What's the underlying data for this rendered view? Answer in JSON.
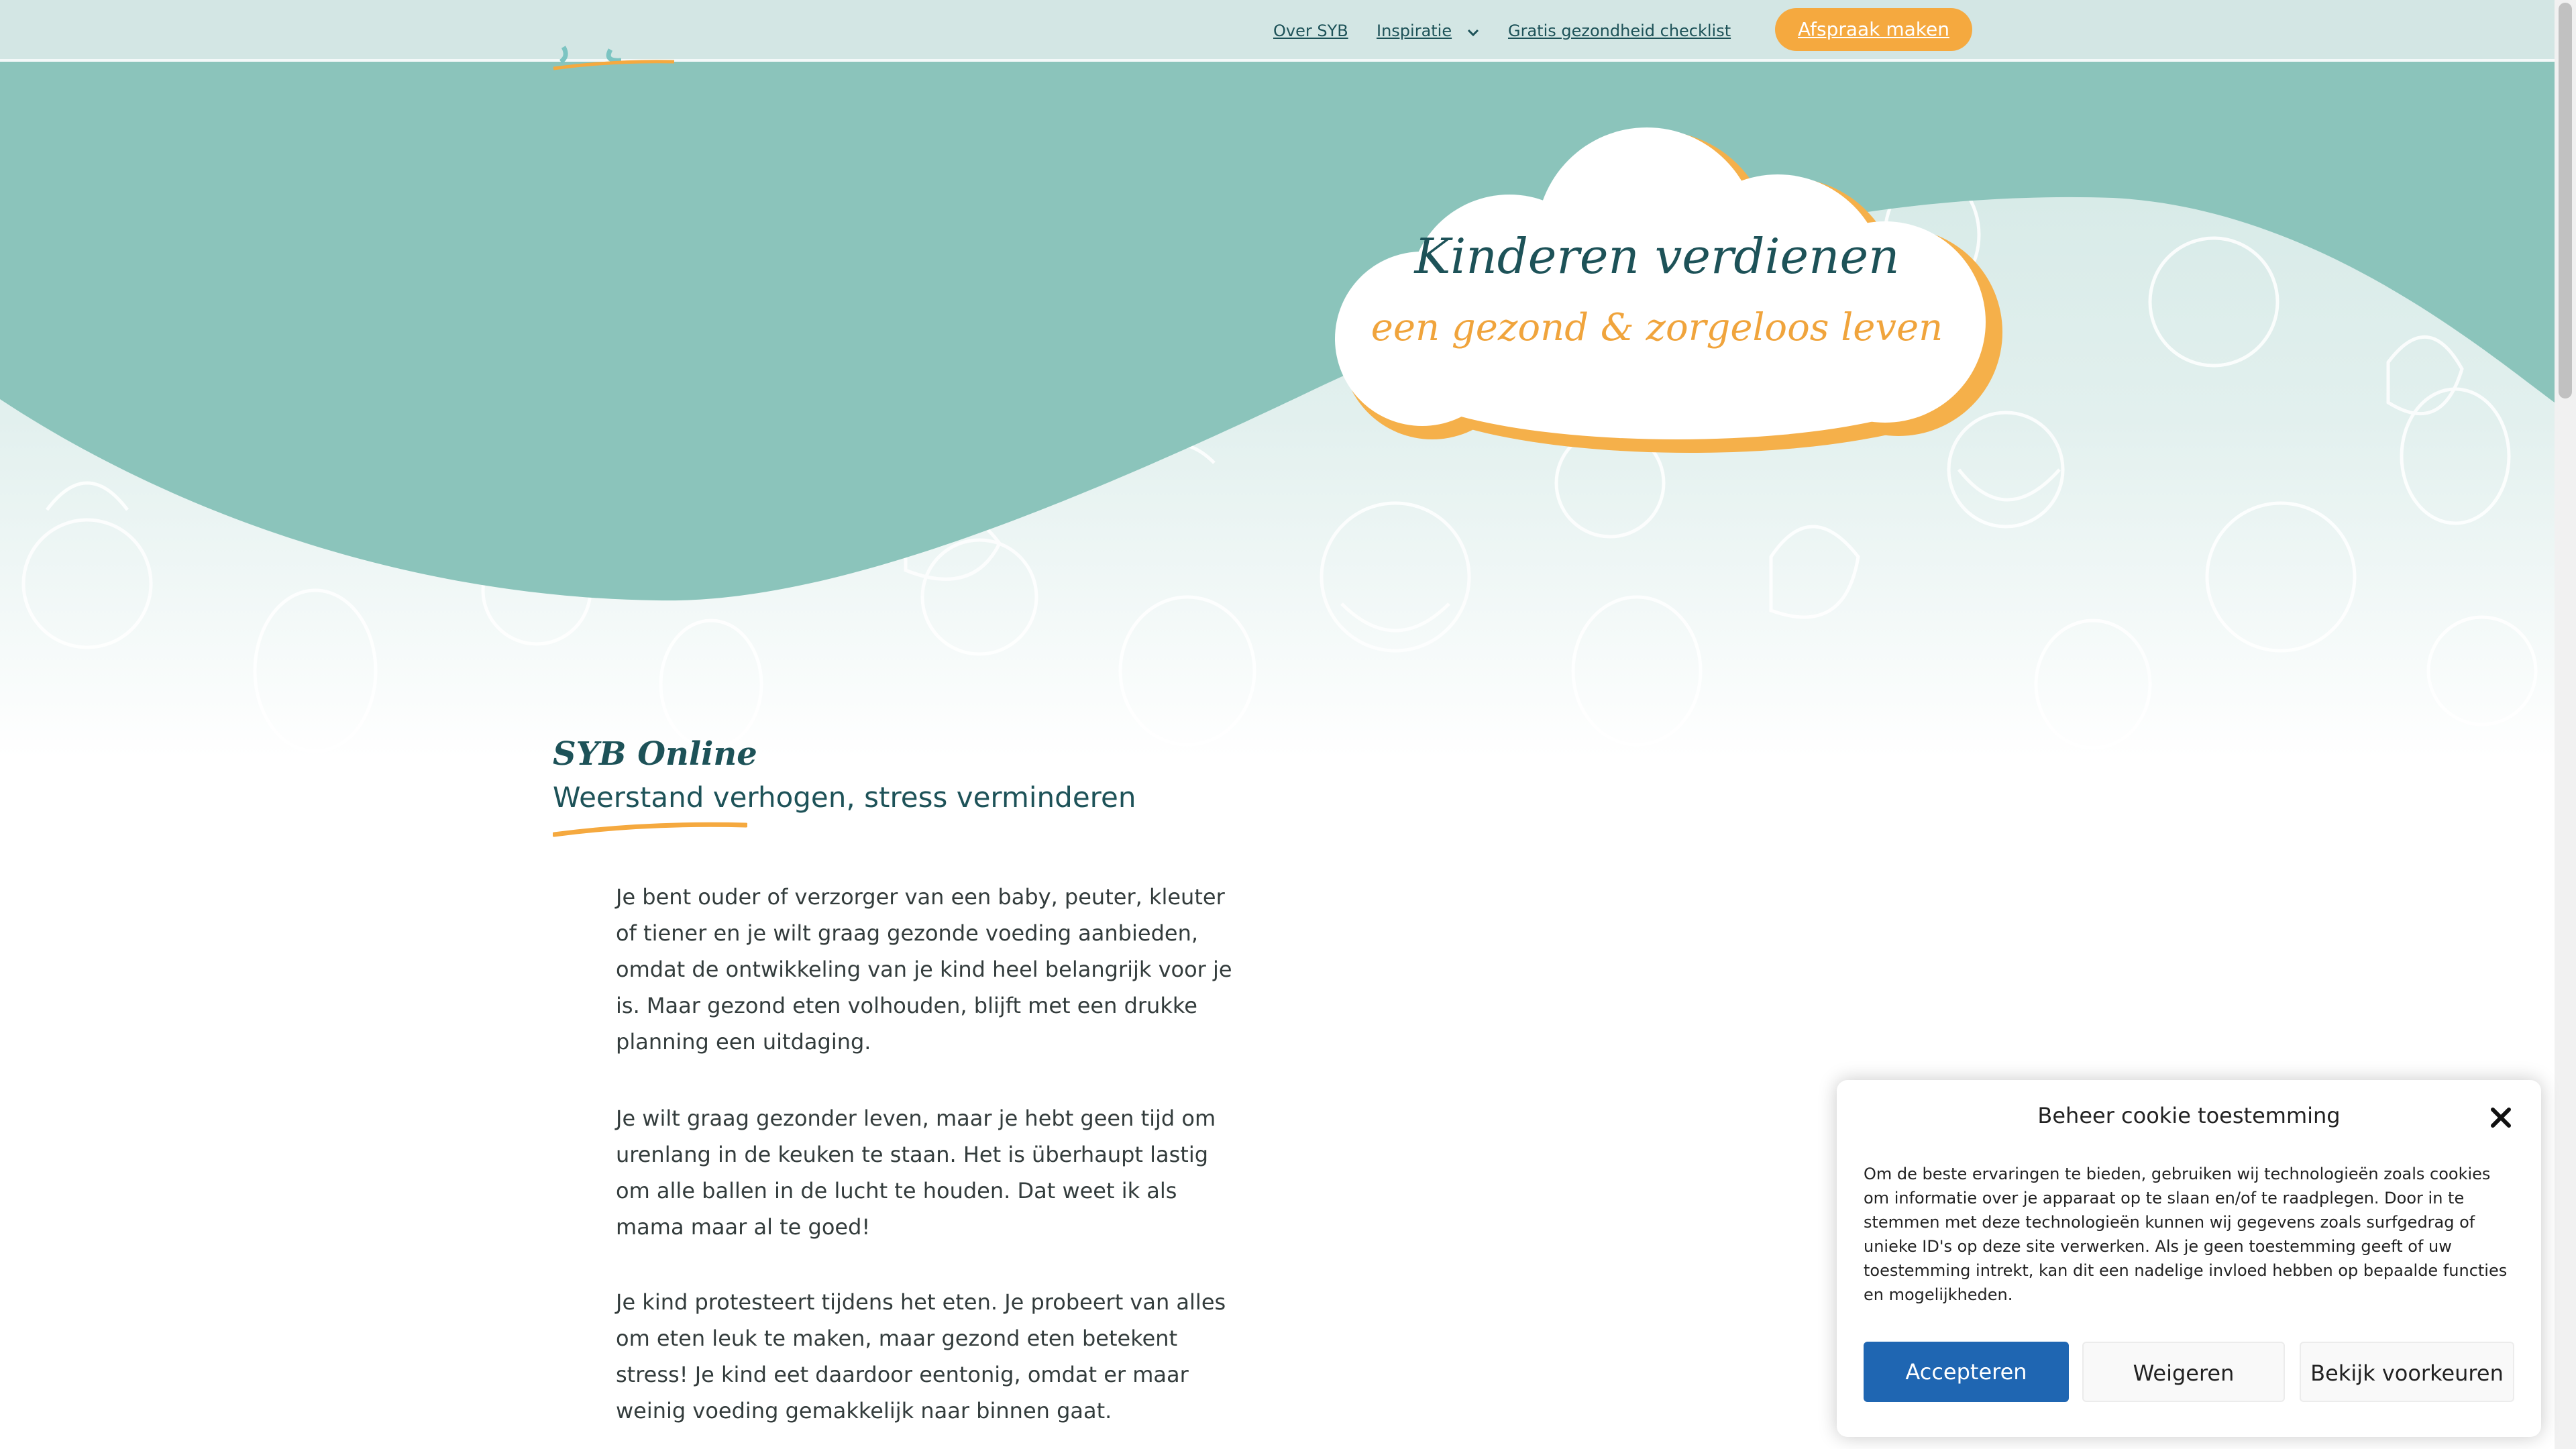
{
  "header": {
    "nav": {
      "over": "Over SYB",
      "inspiratie": "Inspiratie",
      "checklist": "Gratis gezondheid checklist"
    },
    "cta": "Afspraak maken"
  },
  "hero": {
    "title": "Kinderen verdienen",
    "subtitle": "een gezond & zorgeloos leven"
  },
  "section": {
    "title": "SYB Online",
    "subtitle": "Weerstand verhogen, stress verminderen",
    "paragraphs": [
      "Je bent ouder of verzorger van een baby, peuter, kleuter of tiener en je wilt graag gezonde voeding aanbieden, omdat de ontwikkeling van je kind heel belangrijk voor je is. Maar gezond eten volhouden, blijft met een drukke planning een uitdaging.",
      "Je wilt graag gezonder leven, maar je hebt geen tijd om urenlang in de keuken te staan. Het is überhaupt lastig om alle ballen in de lucht te houden. Dat weet ik als mama maar al te goed!",
      "Je kind protesteert tijdens het eten. Je probeert van alles om eten leuk te maken, maar gezond eten betekent stress! Je kind eet daardoor eentonig, omdat er maar weinig voeding gemakkelijk naar binnen gaat."
    ]
  },
  "cookie": {
    "title": "Beheer cookie toestemming",
    "text": "Om de beste ervaringen te bieden, gebruiken wij technologieën zoals cookies om informatie over je apparaat op te slaan en/of te raadplegen. Door in te stemmen met deze technologieën kunnen wij gegevens zoals surfgedrag of unieke ID's op deze site verwerken. Als je geen toestemming geeft of uw toestemming intrekt, kan dit een nadelige invloed hebben op bepaalde functies en mogelijkheden.",
    "accept": "Accepteren",
    "deny": "Weigeren",
    "prefs": "Bekijk voorkeuren"
  },
  "icons": {
    "close": "close-icon",
    "dropdown": "chevron-down-icon"
  },
  "colors": {
    "teal": "#8bc4bb",
    "dark_teal": "#1d5258",
    "orange": "#f5a93f",
    "accept_blue": "#1f66b2",
    "header_bg": "#d3e6e4"
  }
}
